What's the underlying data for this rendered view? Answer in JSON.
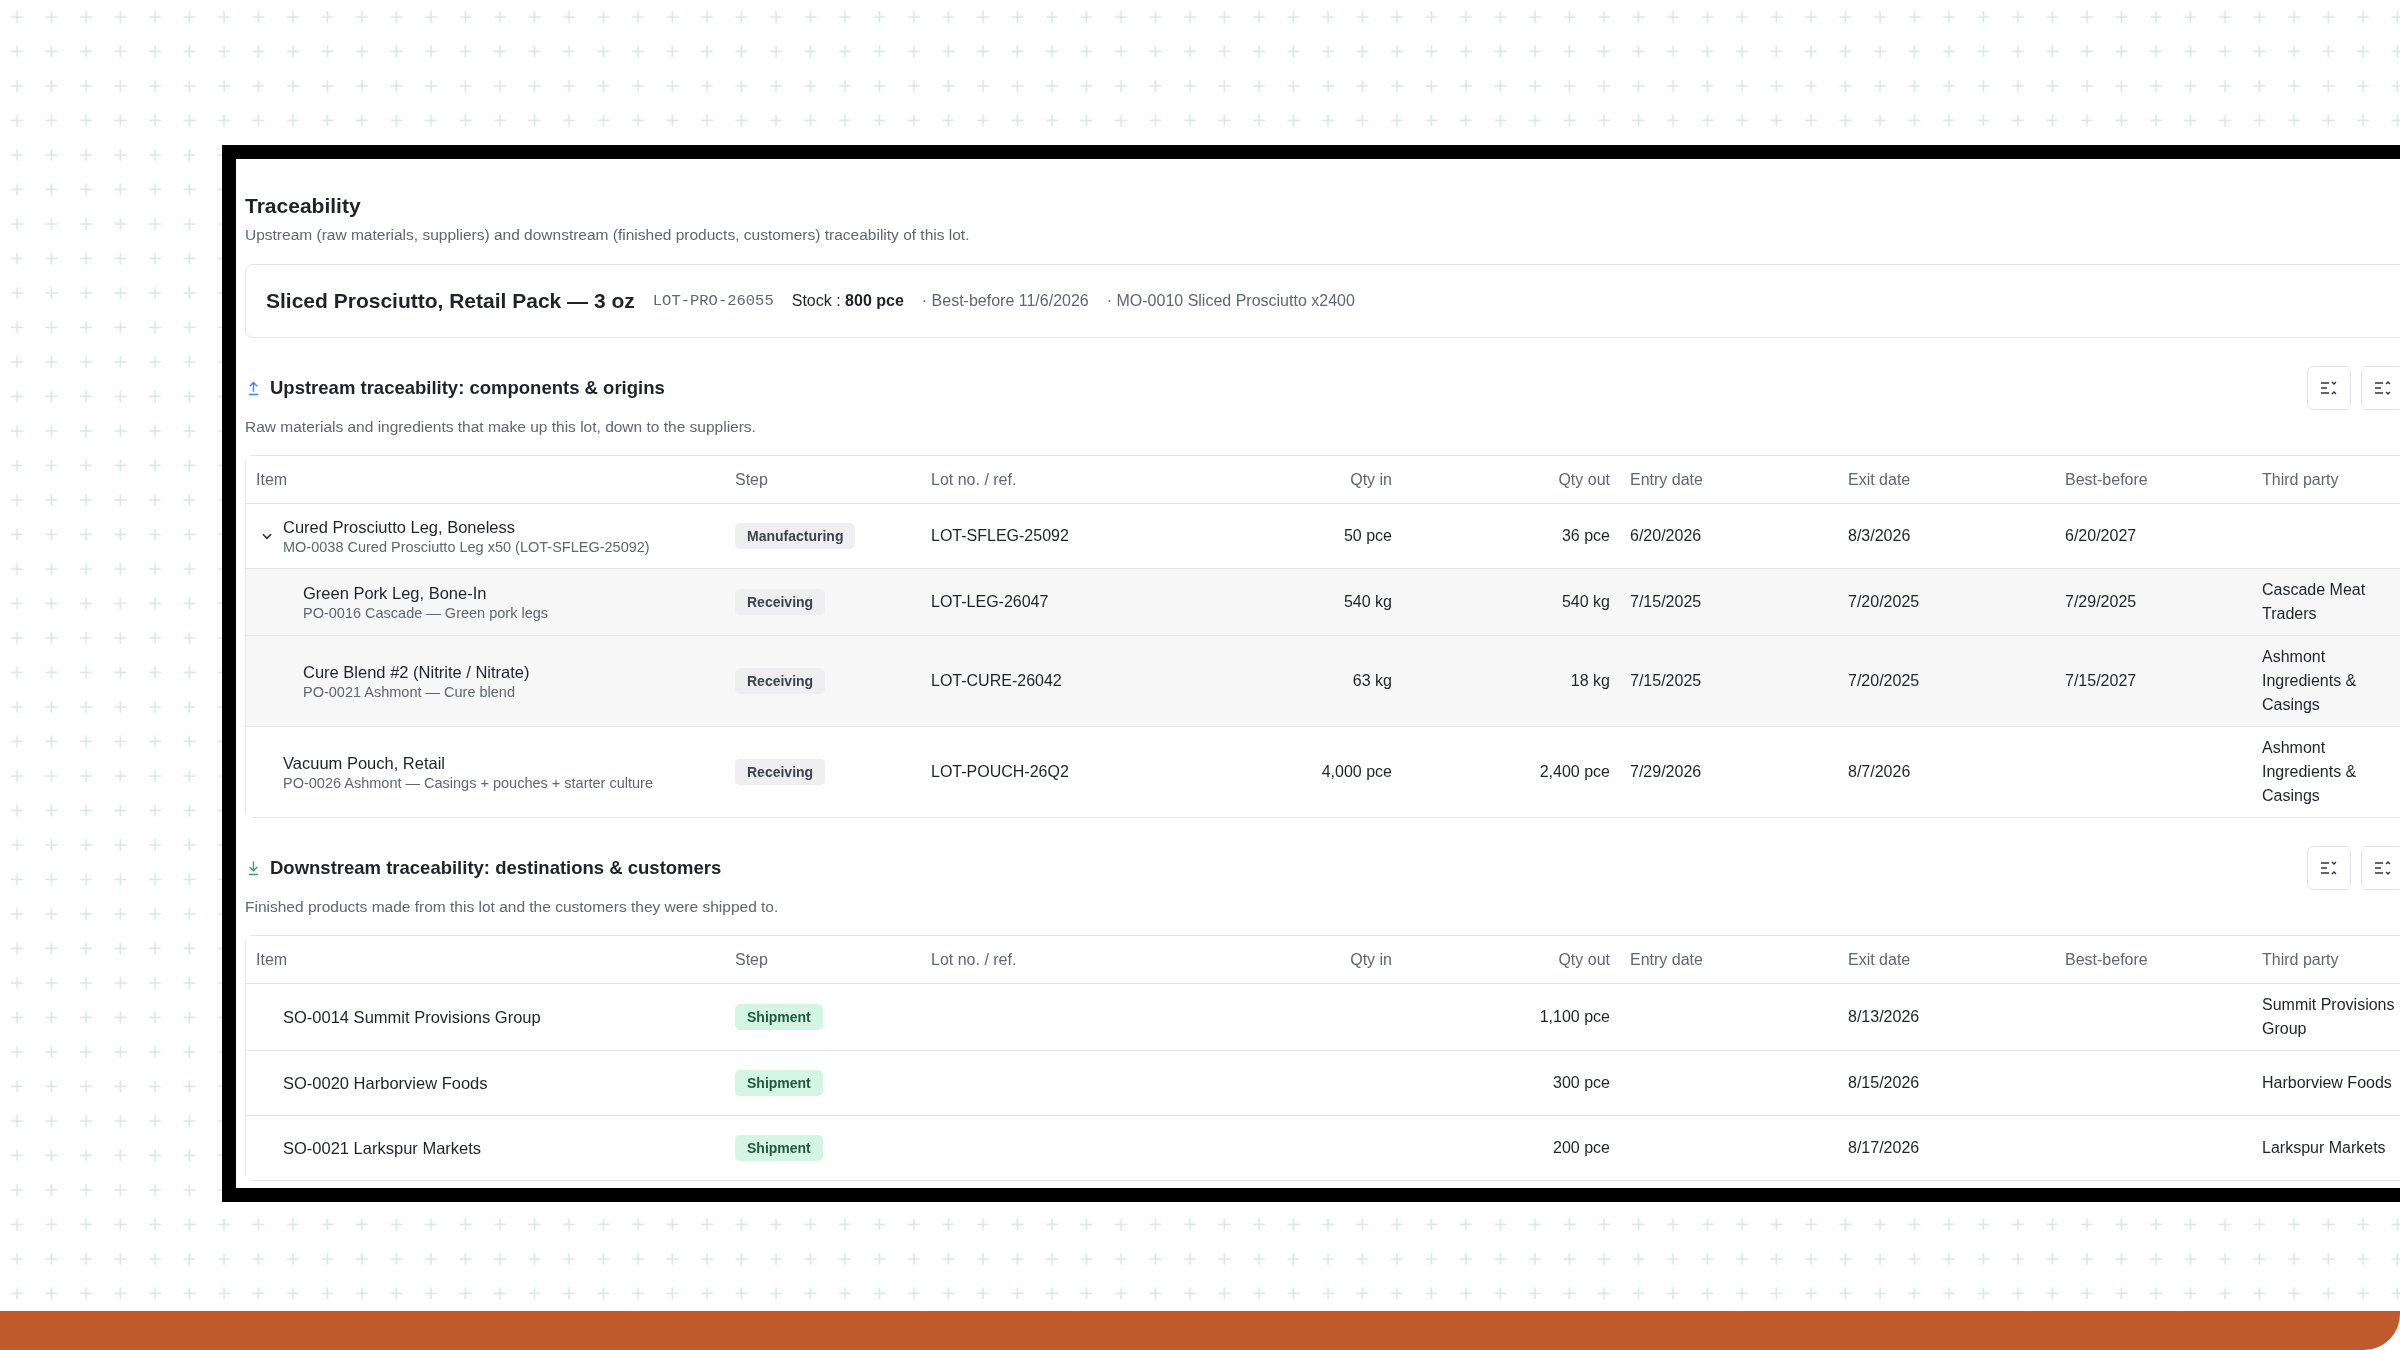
{
  "section": {
    "title": "Traceability",
    "description": "Upstream (raw materials, suppliers) and downstream (finished products, customers) traceability of this lot."
  },
  "lot_card": {
    "name": "Sliced Prosciutto, Retail Pack — 3 oz",
    "lot": "LOT-PRO-26055",
    "stock": "Stock : **800 pce**",
    "best_before": "· Best-before 11/6/2026",
    "origin": "· MO-0010 Sliced Prosciutto x2400"
  },
  "upstream": {
    "title": "Upstream traceability: components & origins",
    "description": "Raw materials and ingredients that make up this lot, down to the suppliers.",
    "columns": [
      "Item",
      "Step",
      "Lot no. / ref.",
      "Qty in",
      "Qty out",
      "Entry date",
      "Exit date",
      "Best-before",
      "Third party"
    ],
    "rows": [
      {
        "item": "Cured Prosciutto Leg, Boneless",
        "ref": "MO-0038 Cured Prosciutto Leg x50 (LOT-SFLEG-25092)",
        "step": {
          "label": "Manufacturing",
          "kind": "neutral"
        },
        "lot": "LOT-SFLEG-25092",
        "qty_in": "50 pce",
        "qty_out": "36 pce",
        "entry_date": "6/20/2026",
        "exit_date": "8/3/2026",
        "best_before": "6/20/2027",
        "expanded": true,
        "children": [
          {
            "item": "Green Pork Leg, Bone-In",
            "ref": "PO-0016 Cascade — Green pork legs",
            "step": {
              "label": "Receiving",
              "kind": "neutral"
            },
            "lot": "LOT-LEG-26047",
            "qty_in": "540 kg",
            "qty_out": "540 kg",
            "entry_date": "7/15/2025",
            "exit_date": "7/20/2025",
            "best_before": "7/29/2025",
            "third_party": "Cascade Meat Traders"
          },
          {
            "item": "Cure Blend #2 (Nitrite / Nitrate)",
            "ref": "PO-0021 Ashmont — Cure blend",
            "step": {
              "label": "Receiving",
              "kind": "neutral"
            },
            "lot": "LOT-CURE-26042",
            "qty_in": "63 kg",
            "qty_out": "18 kg",
            "entry_date": "7/15/2025",
            "exit_date": "7/20/2025",
            "best_before": "7/15/2027",
            "third_party": "Ashmont Ingredients & Casings"
          }
        ]
      },
      {
        "item": "Vacuum Pouch, Retail",
        "ref": "PO-0026 Ashmont — Casings + pouches + starter culture",
        "step": {
          "label": "Receiving",
          "kind": "neutral"
        },
        "lot": "LOT-POUCH-26Q2",
        "qty_in": "4,000 pce",
        "qty_out": "2,400 pce",
        "entry_date": "7/29/2026",
        "exit_date": "8/7/2026",
        "third_party": "Ashmont Ingredients & Casings"
      }
    ]
  },
  "downstream": {
    "title": "Downstream traceability: destinations & customers",
    "description": "Finished products made from this lot and the customers they were shipped to.",
    "columns": [
      "Item",
      "Step",
      "Lot no. / ref.",
      "Qty in",
      "Qty out",
      "Entry date",
      "Exit date",
      "Best-before",
      "Third party"
    ],
    "rows": [
      {
        "item": "SO-0014 Summit Provisions Group",
        "step": {
          "label": "Shipment",
          "kind": "success"
        },
        "qty_out": "1,100 pce",
        "exit_date": "8/13/2026",
        "third_party": "Summit Provisions Group"
      },
      {
        "item": "SO-0020 Harborview Foods",
        "step": {
          "label": "Shipment",
          "kind": "success"
        },
        "qty_out": "300 pce",
        "exit_date": "8/15/2026",
        "third_party": "Harborview Foods"
      },
      {
        "item": "SO-0021 Larkspur Markets",
        "step": {
          "label": "Shipment",
          "kind": "success"
        },
        "qty_out": "200 pce",
        "exit_date": "8/17/2026",
        "third_party": "Larkspur Markets"
      }
    ]
  }
}
